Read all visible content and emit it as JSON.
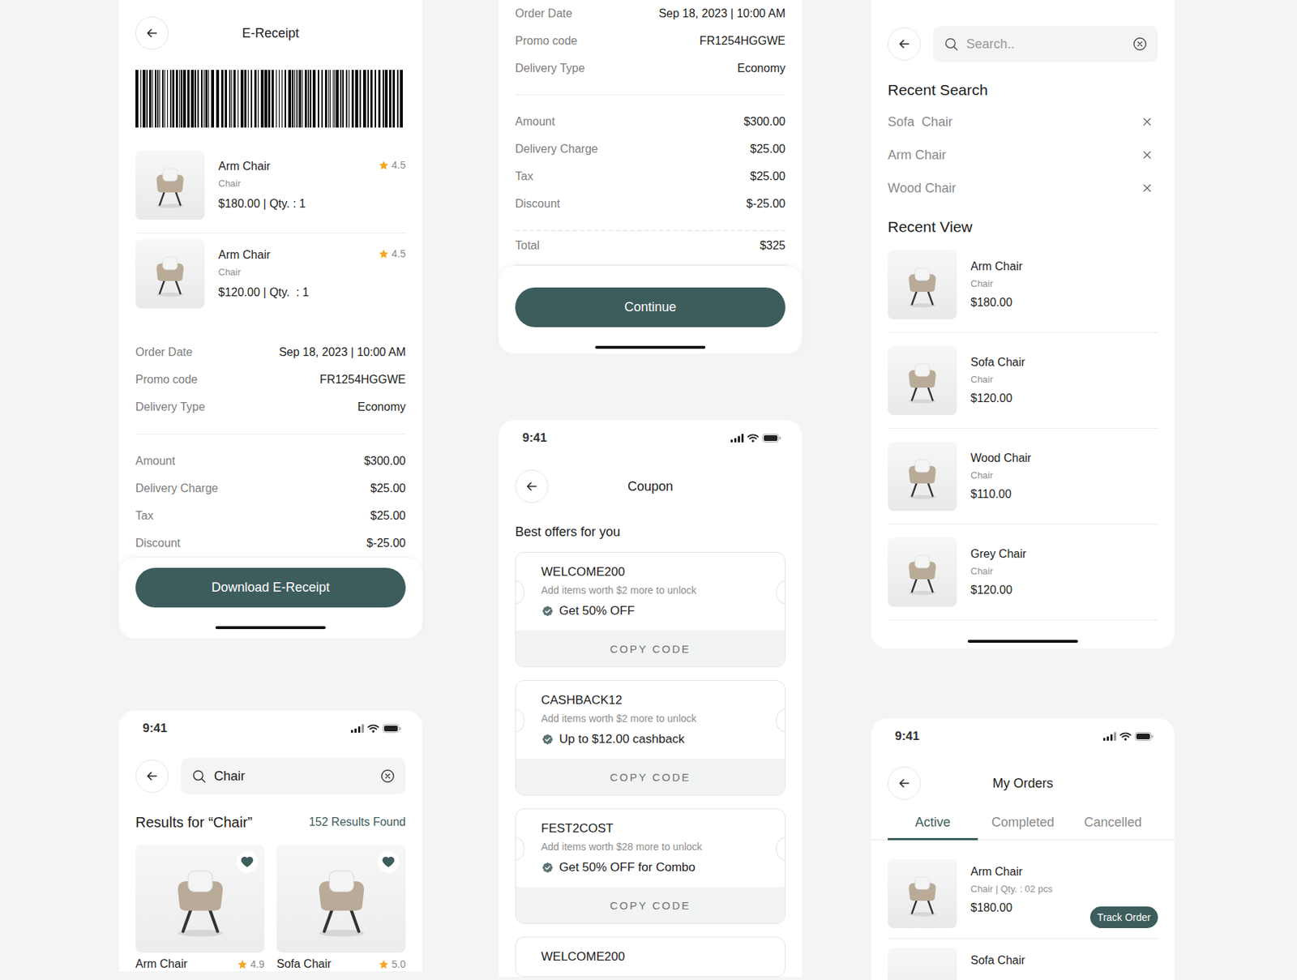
{
  "e_receipt": {
    "title": "E-Receipt",
    "items": [
      {
        "name": "Arm Chair",
        "category": "Chair",
        "price_line": "$180.00 | Qty. : 1",
        "rating": "4.5"
      },
      {
        "name": "Arm Chair",
        "category": "Chair",
        "price_line": "$120.00 | Qty.  : 1",
        "rating": "4.5"
      }
    ],
    "details": [
      {
        "label": "Order Date",
        "value": "Sep 18, 2023 | 10:00 AM"
      },
      {
        "label": "Promo code",
        "value": "FR1254HGGWE"
      },
      {
        "label": "Delivery Type",
        "value": "Economy"
      }
    ],
    "charges": [
      {
        "label": "Amount",
        "value": "$300.00"
      },
      {
        "label": "Delivery Charge",
        "value": "$25.00"
      },
      {
        "label": "Tax",
        "value": "$25.00"
      },
      {
        "label": "Discount",
        "value": "$-25.00"
      }
    ],
    "button": "Download E-Receipt"
  },
  "receipt_summary": {
    "details": [
      {
        "label": "Order Date",
        "value": "Sep 18, 2023 | 10:00 AM"
      },
      {
        "label": "Promo code",
        "value": "FR1254HGGWE"
      },
      {
        "label": "Delivery Type",
        "value": "Economy"
      }
    ],
    "charges": [
      {
        "label": "Amount",
        "value": "$300.00"
      },
      {
        "label": "Delivery Charge",
        "value": "$25.00"
      },
      {
        "label": "Tax",
        "value": "$25.00"
      },
      {
        "label": "Discount",
        "value": "$-25.00"
      }
    ],
    "total": {
      "label": "Total",
      "value": "$325"
    },
    "button": "Continue"
  },
  "coupon": {
    "status_time": "9:41",
    "title": "Coupon",
    "heading": "Best offers for you",
    "coupons": [
      {
        "code": "WELCOME200",
        "condition": "Add items worth $2 more to unlock",
        "offer": "Get 50% OFF",
        "action": "COPY CODE"
      },
      {
        "code": "CASHBACK12",
        "condition": "Add items worth $2 more to unlock",
        "offer": "Up to $12.00 cashback",
        "action": "COPY CODE"
      },
      {
        "code": "FEST2COST",
        "condition": "Add items worth $28 more to unlock",
        "offer": "Get 50% OFF for Combo",
        "action": "COPY CODE"
      }
    ],
    "peek_code": "WELCOME200"
  },
  "search_results": {
    "status_time": "9:41",
    "query": "Chair",
    "heading": "Results for “Chair”",
    "count": "152 Results Found",
    "products": [
      {
        "name": "Arm Chair",
        "rating": "4.9",
        "favorite": true
      },
      {
        "name": "Sofa Chair",
        "rating": "5.0",
        "favorite": true
      }
    ]
  },
  "search": {
    "placeholder": "Search..",
    "recent_title": "Recent Search",
    "recent": [
      "Sofa  Chair",
      "Arm Chair",
      "Wood Chair"
    ],
    "recent_view_title": "Recent View",
    "viewed": [
      {
        "name": "Arm Chair",
        "category": "Chair",
        "price": "$180.00"
      },
      {
        "name": "Sofa Chair",
        "category": "Chair",
        "price": "$120.00"
      },
      {
        "name": "Wood Chair",
        "category": "Chair",
        "price": "$110.00"
      },
      {
        "name": "Grey Chair",
        "category": "Chair",
        "price": "$120.00"
      }
    ]
  },
  "orders": {
    "status_time": "9:41",
    "title": "My Orders",
    "tabs": [
      {
        "label": "Active",
        "selected": true
      },
      {
        "label": "Completed",
        "selected": false
      },
      {
        "label": "Cancelled",
        "selected": false
      }
    ],
    "orders": [
      {
        "name": "Arm Chair",
        "meta": "Chair | Qty. : 02 pcs",
        "price": "$180.00",
        "action": "Track Order"
      }
    ],
    "peek_name": "Sofa Chair"
  }
}
